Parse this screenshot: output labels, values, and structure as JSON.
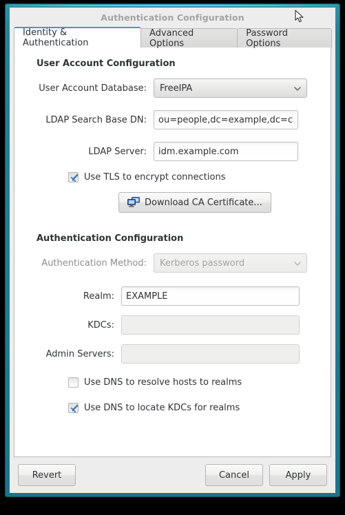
{
  "window": {
    "title": "Authentication Configuration"
  },
  "tabs": [
    {
      "label": "Identity & Authentication",
      "active": true
    },
    {
      "label": "Advanced Options",
      "active": false
    },
    {
      "label": "Password Options",
      "active": false
    }
  ],
  "user_account_section": {
    "title": "User Account Configuration",
    "user_account_database": {
      "label": "User Account Database:",
      "value": "FreeIPA",
      "icon": "chevron-down-icon"
    },
    "ldap_search_base_dn": {
      "label": "LDAP Search Base DN:",
      "value": "ou=people,dc=example,dc=co"
    },
    "ldap_server": {
      "label": "LDAP Server:",
      "value": "idm.example.com"
    },
    "use_tls": {
      "label": "Use TLS to encrypt connections",
      "checked": true
    },
    "download_ca_button": {
      "label": "Download CA Certificate...",
      "icon": "network-computers-icon"
    }
  },
  "authentication_section": {
    "title": "Authentication Configuration",
    "authentication_method": {
      "label": "Authentication Method:",
      "value": "Kerberos password",
      "disabled": true,
      "icon": "chevron-down-icon"
    },
    "realm": {
      "label": "Realm:",
      "value": "EXAMPLE"
    },
    "kdcs": {
      "label": "KDCs:",
      "value": "",
      "disabled": true
    },
    "admin_servers": {
      "label": "Admin Servers:",
      "value": "",
      "disabled": true
    },
    "use_dns_resolve_hosts": {
      "label": "Use DNS to resolve hosts to realms",
      "checked": false
    },
    "use_dns_locate_kdcs": {
      "label": "Use DNS to locate KDCs for realms",
      "checked": true
    }
  },
  "actions": {
    "revert": "Revert",
    "cancel": "Cancel",
    "apply": "Apply"
  },
  "colors": {
    "window_border": "#1d7d92",
    "active_tab_accent": "#4a90d9",
    "dialog_bg": "#ededed",
    "page_bg": "#ffffff",
    "check_blue": "#3a76c4"
  }
}
